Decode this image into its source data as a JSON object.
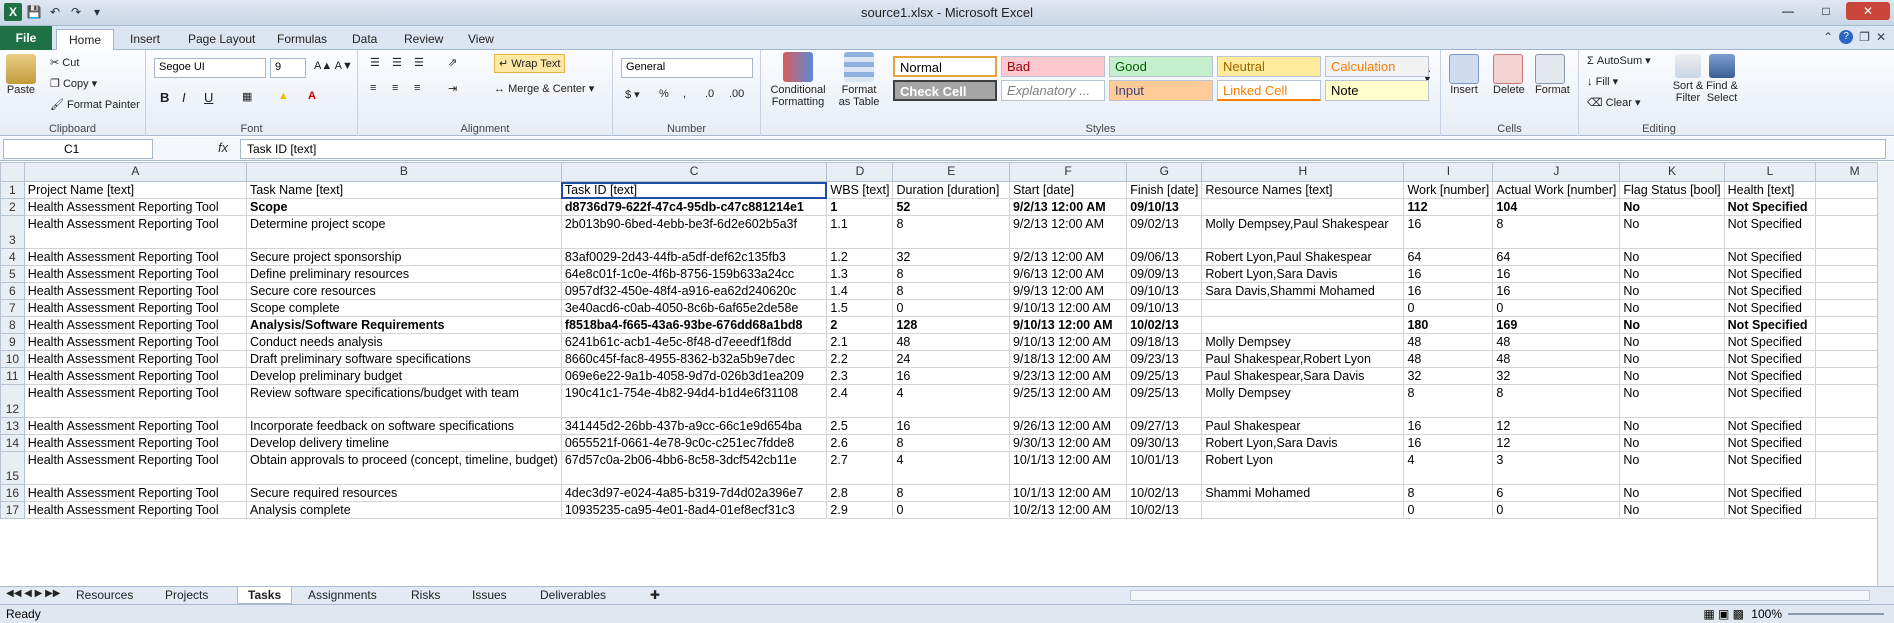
{
  "window": {
    "title": "source1.xlsx - Microsoft Excel"
  },
  "ribbon_tabs": [
    "File",
    "Home",
    "Insert",
    "Page Layout",
    "Formulas",
    "Data",
    "Review",
    "View"
  ],
  "clipboard": {
    "paste": "Paste",
    "cut": "Cut",
    "copy": "Copy",
    "format_painter": "Format Painter",
    "label": "Clipboard"
  },
  "font": {
    "name": "Segoe UI",
    "size": "9",
    "label": "Font"
  },
  "alignment": {
    "wrap": "Wrap Text",
    "merge": "Merge & Center",
    "label": "Alignment"
  },
  "number": {
    "format": "General",
    "label": "Number"
  },
  "styles": {
    "label": "Styles",
    "conditional": "Conditional Formatting",
    "format_table": "Format as Table",
    "items": [
      {
        "name": "Normal",
        "bg": "#ffffff",
        "fg": "#000000"
      },
      {
        "name": "Bad",
        "bg": "#ffc7ce",
        "fg": "#9c0006"
      },
      {
        "name": "Good",
        "bg": "#c6efce",
        "fg": "#006100"
      },
      {
        "name": "Neutral",
        "bg": "#ffeb9c",
        "fg": "#9c6500"
      },
      {
        "name": "Calculation",
        "bg": "#f2f2f2",
        "fg": "#fa7d00"
      },
      {
        "name": "Check Cell",
        "bg": "#a5a5a5",
        "fg": "#ffffff"
      },
      {
        "name": "Explanatory ...",
        "bg": "#ffffff",
        "fg": "#7f7f7f"
      },
      {
        "name": "Input",
        "bg": "#ffcc99",
        "fg": "#3f3f76"
      },
      {
        "name": "Linked Cell",
        "bg": "#ffffff",
        "fg": "#fa7d00"
      },
      {
        "name": "Note",
        "bg": "#ffffcc",
        "fg": "#000000"
      }
    ]
  },
  "cells_group": {
    "insert": "Insert",
    "delete": "Delete",
    "format": "Format",
    "label": "Cells"
  },
  "editing": {
    "autosum": "AutoSum",
    "fill": "Fill",
    "clear": "Clear",
    "sort": "Sort & Filter",
    "find": "Find & Select",
    "label": "Editing"
  },
  "formula_bar": {
    "name_box": "C1",
    "fx": "fx",
    "content": "Task ID [text]"
  },
  "columns": [
    "A",
    "B",
    "C",
    "D",
    "E",
    "F",
    "G",
    "H",
    "I",
    "J",
    "K",
    "L",
    "M"
  ],
  "rows": [
    {
      "n": "1",
      "bold": false,
      "cells": [
        "Project Name [text]",
        "Task Name [text]",
        "Task ID [text]",
        "WBS [text]",
        "Duration [duration]",
        "Start [date]",
        "Finish [date]",
        "Resource Names [text]",
        "Work [number]",
        "Actual Work [number]",
        "Flag Status [bool]",
        "Health [text]"
      ]
    },
    {
      "n": "2",
      "bold": true,
      "cells": [
        "Health Assessment Reporting Tool",
        "Scope",
        "d8736d79-622f-47c4-95db-c47c881214e1",
        "1",
        "52",
        "9/2/13 12:00 AM",
        "09/10/13",
        "",
        "112",
        "104",
        "No",
        "Not Specified"
      ]
    },
    {
      "n": "3",
      "bold": false,
      "cells": [
        "Health Assessment Reporting Tool",
        "Determine project scope",
        "2b013b90-6bed-4ebb-be3f-6d2e602b5a3f",
        "1.1",
        "8",
        "9/2/13 12:00 AM",
        "09/02/13",
        "Molly Dempsey,Paul Shakespear",
        "16",
        "8",
        "No",
        "Not Specified"
      ]
    },
    {
      "n": "4",
      "bold": false,
      "cells": [
        "Health Assessment Reporting Tool",
        "Secure project sponsorship",
        "83af0029-2d43-44fb-a5df-def62c135fb3",
        "1.2",
        "32",
        "9/2/13 12:00 AM",
        "09/06/13",
        "Robert Lyon,Paul Shakespear",
        "64",
        "64",
        "No",
        "Not Specified"
      ]
    },
    {
      "n": "5",
      "bold": false,
      "cells": [
        "Health Assessment Reporting Tool",
        "Define preliminary resources",
        "64e8c01f-1c0e-4f6b-8756-159b633a24cc",
        "1.3",
        "8",
        "9/6/13 12:00 AM",
        "09/09/13",
        "Robert Lyon,Sara Davis",
        "16",
        "16",
        "No",
        "Not Specified"
      ]
    },
    {
      "n": "6",
      "bold": false,
      "cells": [
        "Health Assessment Reporting Tool",
        "Secure core resources",
        "0957df32-450e-48f4-a916-ea62d240620c",
        "1.4",
        "8",
        "9/9/13 12:00 AM",
        "09/10/13",
        "Sara Davis,Shammi Mohamed",
        "16",
        "16",
        "No",
        "Not Specified"
      ]
    },
    {
      "n": "7",
      "bold": false,
      "cells": [
        "Health Assessment Reporting Tool",
        "Scope complete",
        "3e40acd6-c0ab-4050-8c6b-6af65e2de58e",
        "1.5",
        "0",
        "9/10/13 12:00 AM",
        "09/10/13",
        "",
        "0",
        "0",
        "No",
        "Not Specified"
      ]
    },
    {
      "n": "8",
      "bold": true,
      "cells": [
        "Health Assessment Reporting Tool",
        "Analysis/Software Requirements",
        "f8518ba4-f665-43a6-93be-676dd68a1bd8",
        "2",
        "128",
        "9/10/13 12:00 AM",
        "10/02/13",
        "",
        "180",
        "169",
        "No",
        "Not Specified"
      ]
    },
    {
      "n": "9",
      "bold": false,
      "cells": [
        "Health Assessment Reporting Tool",
        "Conduct needs analysis",
        "6241b61c-acb1-4e5c-8f48-d7eeedf1f8dd",
        "2.1",
        "48",
        "9/10/13 12:00 AM",
        "09/18/13",
        "Molly Dempsey",
        "48",
        "48",
        "No",
        "Not Specified"
      ]
    },
    {
      "n": "10",
      "bold": false,
      "cells": [
        "Health Assessment Reporting Tool",
        "Draft preliminary software specifications",
        "8660c45f-fac8-4955-8362-b32a5b9e7dec",
        "2.2",
        "24",
        "9/18/13 12:00 AM",
        "09/23/13",
        "Paul Shakespear,Robert Lyon",
        "48",
        "48",
        "No",
        "Not Specified"
      ]
    },
    {
      "n": "11",
      "bold": false,
      "cells": [
        "Health Assessment Reporting Tool",
        "Develop preliminary budget",
        "069e6e22-9a1b-4058-9d7d-026b3d1ea209",
        "2.3",
        "16",
        "9/23/13 12:00 AM",
        "09/25/13",
        "Paul Shakespear,Sara Davis",
        "32",
        "32",
        "No",
        "Not Specified"
      ]
    },
    {
      "n": "12",
      "bold": false,
      "cells": [
        "Health Assessment Reporting Tool",
        "Review software specifications/budget with team",
        "190c41c1-754e-4b82-94d4-b1d4e6f31108",
        "2.4",
        "4",
        "9/25/13 12:00 AM",
        "09/25/13",
        "Molly Dempsey",
        "8",
        "8",
        "No",
        "Not Specified"
      ]
    },
    {
      "n": "13",
      "bold": false,
      "cells": [
        "Health Assessment Reporting Tool",
        "Incorporate feedback on software specifications",
        "341445d2-26bb-437b-a9cc-66c1e9d654ba",
        "2.5",
        "16",
        "9/26/13 12:00 AM",
        "09/27/13",
        "Paul Shakespear",
        "16",
        "12",
        "No",
        "Not Specified"
      ]
    },
    {
      "n": "14",
      "bold": false,
      "cells": [
        "Health Assessment Reporting Tool",
        "Develop delivery timeline",
        "0655521f-0661-4e78-9c0c-c251ec7fdde8",
        "2.6",
        "8",
        "9/30/13 12:00 AM",
        "09/30/13",
        "Robert Lyon,Sara Davis",
        "16",
        "12",
        "No",
        "Not Specified"
      ]
    },
    {
      "n": "15",
      "bold": false,
      "cells": [
        "Health Assessment Reporting Tool",
        "Obtain approvals to proceed (concept, timeline, budget)",
        "67d57c0a-2b06-4bb6-8c58-3dcf542cb11e",
        "2.7",
        "4",
        "10/1/13 12:00 AM",
        "10/01/13",
        "Robert Lyon",
        "4",
        "3",
        "No",
        "Not Specified"
      ]
    },
    {
      "n": "16",
      "bold": false,
      "cells": [
        "Health Assessment Reporting Tool",
        "Secure required resources",
        "4dec3d97-e024-4a85-b319-7d4d02a396e7",
        "2.8",
        "8",
        "10/1/13 12:00 AM",
        "10/02/13",
        "Shammi Mohamed",
        "8",
        "6",
        "No",
        "Not Specified"
      ]
    },
    {
      "n": "17",
      "bold": false,
      "cells": [
        "Health Assessment Reporting Tool",
        "Analysis complete",
        "10935235-ca95-4e01-8ad4-01ef8ecf31c3",
        "2.9",
        "0",
        "10/2/13 12:00 AM",
        "10/02/13",
        "",
        "0",
        "0",
        "No",
        "Not Specified"
      ]
    }
  ],
  "sheet_tabs": [
    "Resources",
    "Projects",
    "Tasks",
    "Assignments",
    "Risks",
    "Issues",
    "Deliverables"
  ],
  "active_sheet": "Tasks",
  "status": {
    "left": "Ready",
    "zoom": "100%"
  }
}
